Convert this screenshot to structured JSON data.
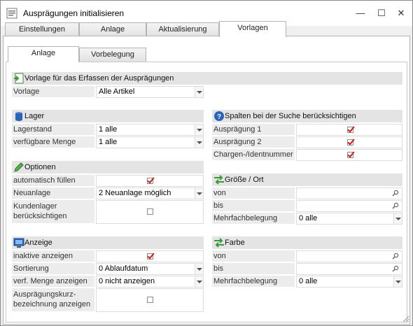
{
  "window": {
    "title": "Ausprägungen initialisieren",
    "controls": {
      "minimize": "—",
      "maximize": "☐",
      "close": "✕"
    }
  },
  "main_tabs": [
    {
      "label": "Einstellungen",
      "active": false
    },
    {
      "label": "Anlage",
      "active": false
    },
    {
      "label": "Aktualisierung",
      "active": false
    },
    {
      "label": "Vorlagen",
      "active": true
    }
  ],
  "sub_tabs": [
    {
      "label": "Anlage",
      "active": true
    },
    {
      "label": "Vorbelegung",
      "active": false
    }
  ],
  "vorlage_section": {
    "title": "Vorlage für das Erfassen der Ausprägungen",
    "icon": "template-icon",
    "vorlage_label": "Vorlage",
    "vorlage_value": "Alle Artikel"
  },
  "lager_section": {
    "title": "Lager",
    "icon": "storage-icon",
    "lagerstand_label": "Lagerstand",
    "lagerstand_value": "1 alle",
    "menge_label": "verfügbare Menge",
    "menge_value": "1 alle"
  },
  "optionen_section": {
    "title": "Optionen",
    "icon": "pencil-icon",
    "auto_label": "automatisch füllen",
    "auto_checked": true,
    "neuanlage_label": "Neuanlage",
    "neuanlage_value": "2 Neuanlage möglich",
    "kundenlager_label": "Kundenlager berücksichtigen",
    "kundenlager_checked": false
  },
  "anzeige_section": {
    "title": "Anzeige",
    "icon": "monitor-icon",
    "inaktive_label": "inaktive anzeigen",
    "inaktive_checked": true,
    "sortierung_label": "Sortierung",
    "sortierung_value": "0 Ablaufdatum",
    "menge_label": "verf. Menge anzeigen",
    "menge_value": "0 nicht anzeigen",
    "kurz_label": "Ausprägungskurz-bezeichnung anzeigen",
    "kurz_checked": false
  },
  "spalten_section": {
    "title": "Spalten bei der Suche berücksichtigen",
    "icon": "help-icon",
    "items": [
      {
        "label": "Ausprägung 1",
        "checked": true
      },
      {
        "label": "Ausprägung 2",
        "checked": true
      },
      {
        "label": "Chargen-/Identnummer",
        "checked": true
      }
    ]
  },
  "groesse_section": {
    "title": "Größe / Ort",
    "icon": "arrows-icon",
    "von_label": "von",
    "von_value": "",
    "bis_label": "bis",
    "bis_value": "",
    "mehrfach_label": "Mehrfachbelegung",
    "mehrfach_value": "0 alle"
  },
  "farbe_section": {
    "title": "Farbe",
    "icon": "arrows-icon",
    "von_label": "von",
    "von_value": "",
    "bis_label": "bis",
    "bis_value": "",
    "mehrfach_label": "Mehrfachbelegung",
    "mehrfach_value": "0 alle"
  },
  "colors": {
    "accent": "#d01818",
    "section_bg": "#e4e4e4",
    "label_bg": "#ececec",
    "icon_blue": "#2a63b8",
    "icon_green": "#3a9a3a"
  }
}
